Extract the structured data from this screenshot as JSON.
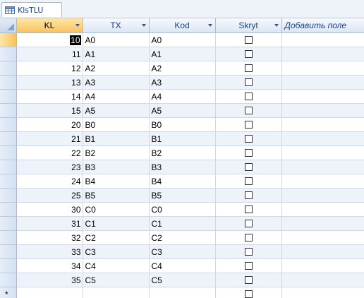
{
  "tab": {
    "label": "KlsTLU",
    "icon": "table-icon"
  },
  "columns": {
    "kl": "KL",
    "tx": "TX",
    "kod": "Kod",
    "skryt": "Skryt",
    "add": "Добавить поле"
  },
  "rows": [
    {
      "kl": "10",
      "tx": "A0",
      "kod": "A0",
      "skryt": false
    },
    {
      "kl": "11",
      "tx": "A1",
      "kod": "A1",
      "skryt": false
    },
    {
      "kl": "12",
      "tx": "A2",
      "kod": "A2",
      "skryt": false
    },
    {
      "kl": "13",
      "tx": "A3",
      "kod": "A3",
      "skryt": false
    },
    {
      "kl": "14",
      "tx": "A4",
      "kod": "A4",
      "skryt": false
    },
    {
      "kl": "15",
      "tx": "A5",
      "kod": "A5",
      "skryt": false
    },
    {
      "kl": "20",
      "tx": "B0",
      "kod": "B0",
      "skryt": false
    },
    {
      "kl": "21",
      "tx": "B1",
      "kod": "B1",
      "skryt": false
    },
    {
      "kl": "22",
      "tx": "B2",
      "kod": "B2",
      "skryt": false
    },
    {
      "kl": "23",
      "tx": "B3",
      "kod": "B3",
      "skryt": false
    },
    {
      "kl": "24",
      "tx": "B4",
      "kod": "B4",
      "skryt": false
    },
    {
      "kl": "25",
      "tx": "B5",
      "kod": "B5",
      "skryt": false
    },
    {
      "kl": "30",
      "tx": "C0",
      "kod": "C0",
      "skryt": false
    },
    {
      "kl": "31",
      "tx": "C1",
      "kod": "C1",
      "skryt": false
    },
    {
      "kl": "32",
      "tx": "C2",
      "kod": "C2",
      "skryt": false
    },
    {
      "kl": "33",
      "tx": "C3",
      "kod": "C3",
      "skryt": false
    },
    {
      "kl": "34",
      "tx": "C4",
      "kod": "C4",
      "skryt": false
    },
    {
      "kl": "35",
      "tx": "C5",
      "kod": "C5",
      "skryt": false
    }
  ],
  "new_row": {
    "marker": "*",
    "skryt": false
  },
  "current_row": 0
}
